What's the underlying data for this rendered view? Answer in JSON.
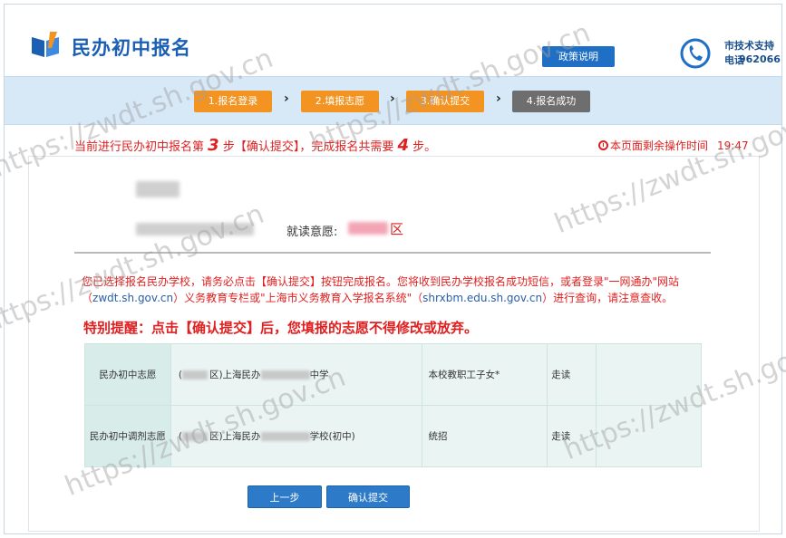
{
  "header": {
    "title": "民办初中报名",
    "policy_button": "政策说明",
    "hotline_label": "市技术支持电话",
    "hotline_number": "962066"
  },
  "steps": [
    {
      "label": "1.报名登录",
      "state": "done"
    },
    {
      "label": "2.填报志愿",
      "state": "done"
    },
    {
      "label": "3.确认提交",
      "state": "done"
    },
    {
      "label": "4.报名成功",
      "state": "todo"
    }
  ],
  "progress": {
    "prefix": "当前进行民办初中报名第",
    "current_step": "3",
    "middle": "步【确认提交】，完成报名共需要",
    "total_steps": "4",
    "suffix": "步。"
  },
  "timer": {
    "label": "本页面剩余操作时间",
    "value": "19:47"
  },
  "student": {
    "intent_label": "就读意愿:",
    "intent_suffix": "区"
  },
  "notice": {
    "p1": "您已选择报名民办学校，请务必点击【确认提交】按钮完成报名。您将收到民办学校报名成功短信，或者登录\"一网通办\"网站（",
    "link1": "zwdt.sh.gov.cn",
    "p2": "）义务教育专栏或\"上海市义务教育入学报名系统\"（",
    "link2": "shrxbm.edu.sh.gov.cn",
    "p3": "）进行查询，请注意查收。"
  },
  "warning": "特别提醒：点击【确认提交】后，您填报的志愿不得修改或放弃。",
  "table": {
    "rows": [
      {
        "head": "民办初中志愿",
        "school_prefix": "(",
        "school_mid": "区)上海民办",
        "school_suffix": "中学",
        "type": "本校教职工子女*",
        "mode": "走读"
      },
      {
        "head": "民办初中调剂志愿",
        "school_prefix": "(",
        "school_mid": "区)上海民办",
        "school_suffix": "学校(初中)",
        "type": "统招",
        "mode": "走读"
      }
    ]
  },
  "buttons": {
    "prev": "上一步",
    "confirm": "确认提交"
  },
  "watermark": "https://zwdt.sh.gov.cn",
  "colors": {
    "brand": "#1a5fb4",
    "step_done": "#f39422",
    "step_todo": "#6e6e6e",
    "alert": "#e02020",
    "button": "#2d7ac9"
  }
}
